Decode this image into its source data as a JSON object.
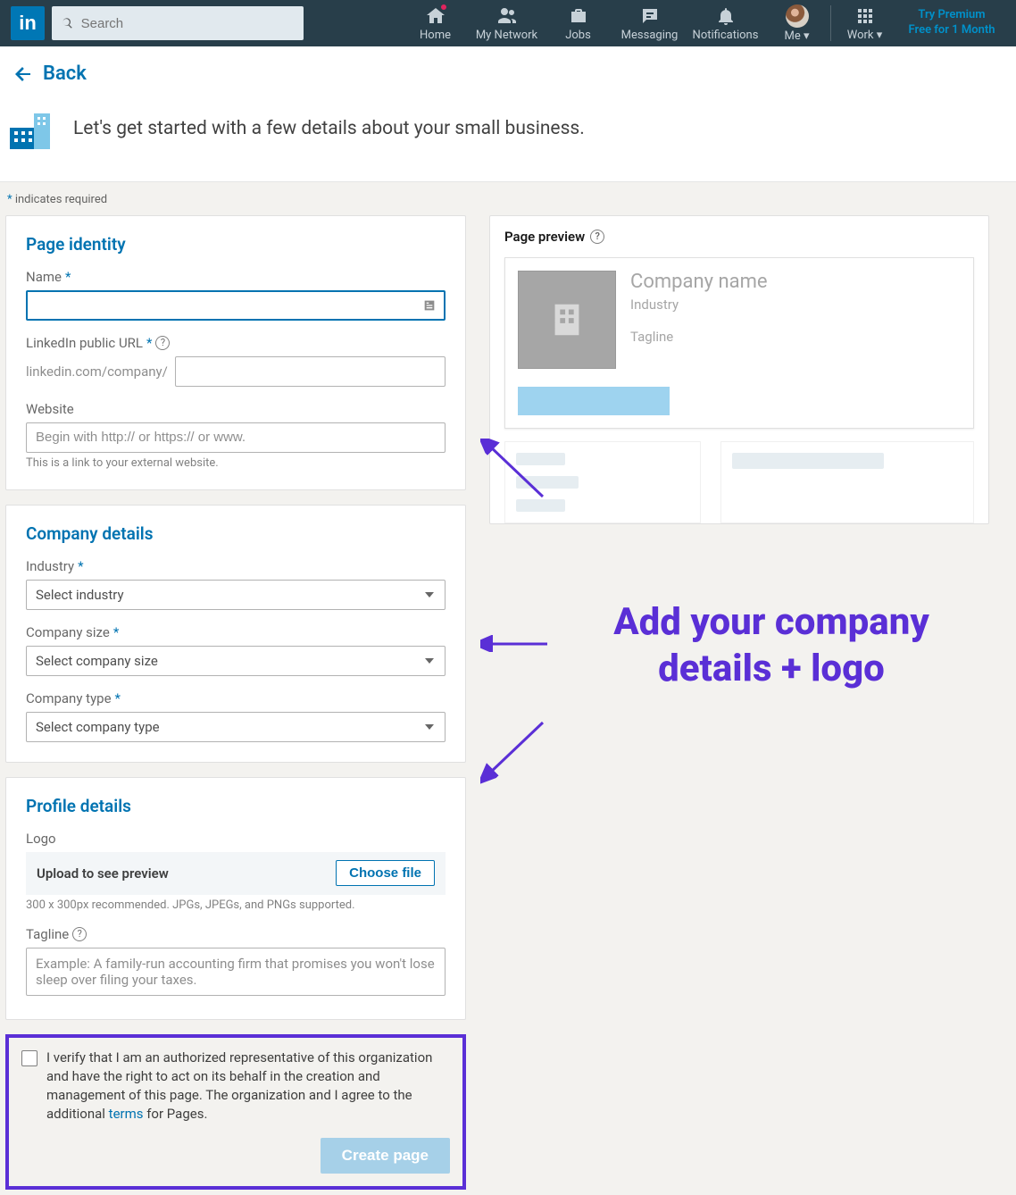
{
  "nav": {
    "search_placeholder": "Search",
    "home": "Home",
    "network": "My Network",
    "jobs": "Jobs",
    "messaging": "Messaging",
    "notifications": "Notifications",
    "me": "Me",
    "work": "Work",
    "premium_l1": "Try Premium",
    "premium_l2": "Free for 1 Month"
  },
  "back": "Back",
  "intro": "Let's get started with a few details about your small business.",
  "required_note": "indicates required",
  "identity": {
    "heading": "Page identity",
    "name_label": "Name",
    "url_label": "LinkedIn public URL",
    "url_prefix": "linkedin.com/company/",
    "website_label": "Website",
    "website_placeholder": "Begin with http:// or https:// or www.",
    "website_hint": "This is a link to your external website."
  },
  "company": {
    "heading": "Company details",
    "industry_label": "Industry",
    "industry_value": "Select industry",
    "size_label": "Company size",
    "size_value": "Select company size",
    "type_label": "Company type",
    "type_value": "Select company type"
  },
  "profile": {
    "heading": "Profile details",
    "logo_label": "Logo",
    "upload_text": "Upload to see preview",
    "choose": "Choose file",
    "logo_hint": "300 x 300px recommended. JPGs, JPEGs, and PNGs supported.",
    "tagline_label": "Tagline",
    "tagline_placeholder": "Example: A family-run accounting firm that promises you won't lose sleep over filing your taxes."
  },
  "verify": {
    "text_pre": "I verify that I am an authorized representative of this organization and have the right to act on its behalf in the creation and management of this page. The organization and I agree to the additional ",
    "terms": "terms",
    "text_post": " for Pages.",
    "button": "Create page"
  },
  "preview": {
    "title": "Page preview",
    "company": "Company name",
    "industry": "Industry",
    "tagline": "Tagline"
  },
  "annotation": "Add your company details + logo"
}
